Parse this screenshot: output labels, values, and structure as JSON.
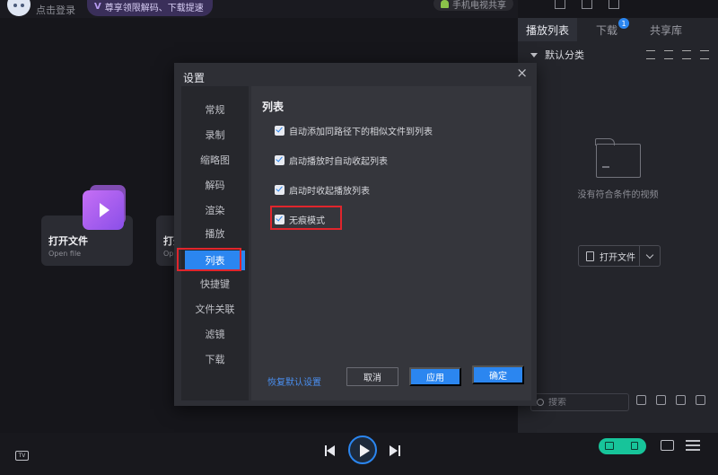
{
  "topbar": {
    "login_label": "点击登录",
    "vip_banner": "尊享领限解码、下载提速",
    "phone_cast": "手机电视共享"
  },
  "cards": [
    {
      "title": "打开文件",
      "subtitle": "Open file"
    },
    {
      "title": "打开",
      "subtitle": "Op"
    }
  ],
  "playlist": {
    "tabs": [
      {
        "label": "播放列表"
      },
      {
        "label": "下载",
        "badge": "1"
      },
      {
        "label": "共享库"
      }
    ],
    "category": "默认分类",
    "empty_text": "没有符合条件的视频",
    "open_button": "打开文件",
    "search_placeholder": "搜索"
  },
  "dialog": {
    "title": "设置",
    "nav": [
      "常规",
      "录制",
      "缩略图",
      "解码",
      "渲染",
      "播放",
      "列表",
      "快捷键",
      "文件关联",
      "滤镜",
      "下载"
    ],
    "active_nav": "列表",
    "section_title": "列表",
    "options": [
      {
        "label": "自动添加同路径下的相似文件到列表",
        "checked": true
      },
      {
        "label": "启动播放时自动收起列表",
        "checked": true
      },
      {
        "label": "启动时收起播放列表",
        "checked": true
      },
      {
        "label": "无痕模式",
        "checked": true
      }
    ],
    "restore_label": "恢复默认设置",
    "cancel_label": "取消",
    "apply_label": "应用",
    "ok_label": "确定"
  },
  "controls": {
    "tv_label": "TV"
  },
  "colors": {
    "accent": "#2b86f0",
    "highlight": "#e0252c",
    "sync": "#17c49a"
  }
}
